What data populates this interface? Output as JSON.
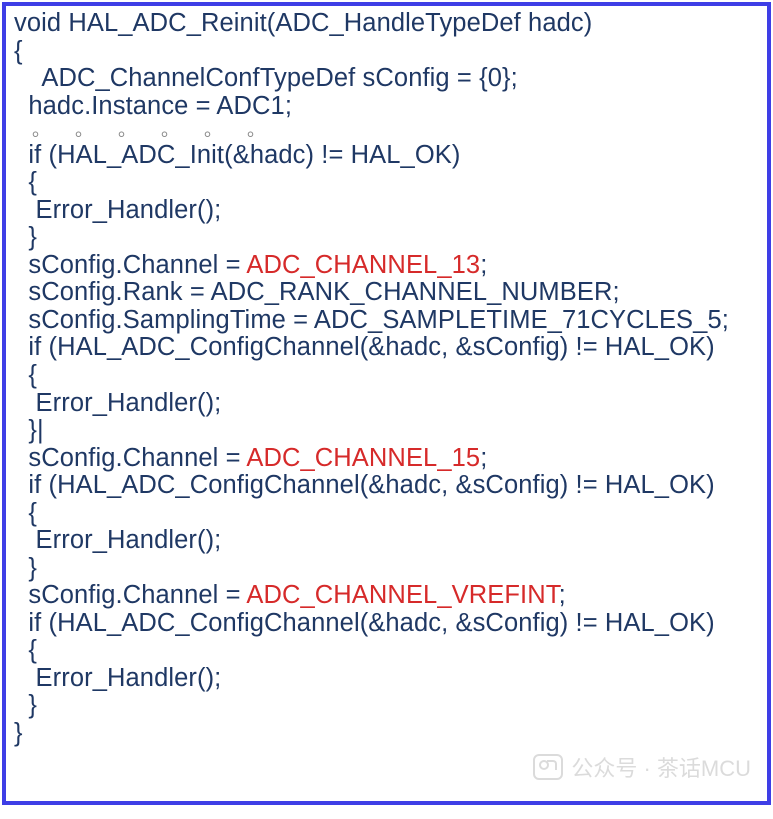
{
  "code": {
    "l1": "void HAL_ADC_Reinit(ADC_HandleTypeDef hadc)",
    "l2": "{",
    "l3": "    ADC_ChannelConfTypeDef sConfig = {0};",
    "l4": "  hadc.Instance = ADC1;",
    "l5_dots": "。 。 。 。 。 。",
    "l6": "  if (HAL_ADC_Init(&hadc) != HAL_OK)",
    "l7": "  {",
    "l8": "   Error_Handler();",
    "l9": "  }",
    "l10a": "  sConfig.Channel = ",
    "l10b": "ADC_CHANNEL_13",
    "l10c": ";",
    "l11": "  sConfig.Rank = ADC_RANK_CHANNEL_NUMBER;",
    "l12": "  sConfig.SamplingTime = ADC_SAMPLETIME_71CYCLES_5;",
    "l13": "  if (HAL_ADC_ConfigChannel(&hadc, &sConfig) != HAL_OK)",
    "l14": "  {",
    "l15": "   Error_Handler();",
    "l16": "  }|",
    "l17a": "  sConfig.Channel = ",
    "l17b": "ADC_CHANNEL_15",
    "l17c": ";",
    "l18": "  if (HAL_ADC_ConfigChannel(&hadc, &sConfig) != HAL_OK)",
    "l19": "  {",
    "l20": "   Error_Handler();",
    "l21": "  }",
    "l22a": "  sConfig.Channel = ",
    "l22b": "ADC_CHANNEL_VREFINT",
    "l22c": ";",
    "l23": "  if (HAL_ADC_ConfigChannel(&hadc, &sConfig) != HAL_OK)",
    "l24": "  {",
    "l25": "   Error_Handler();",
    "l26": "  }",
    "l27": "}"
  },
  "watermark": {
    "text": "公众号 · 茶话MCU"
  }
}
